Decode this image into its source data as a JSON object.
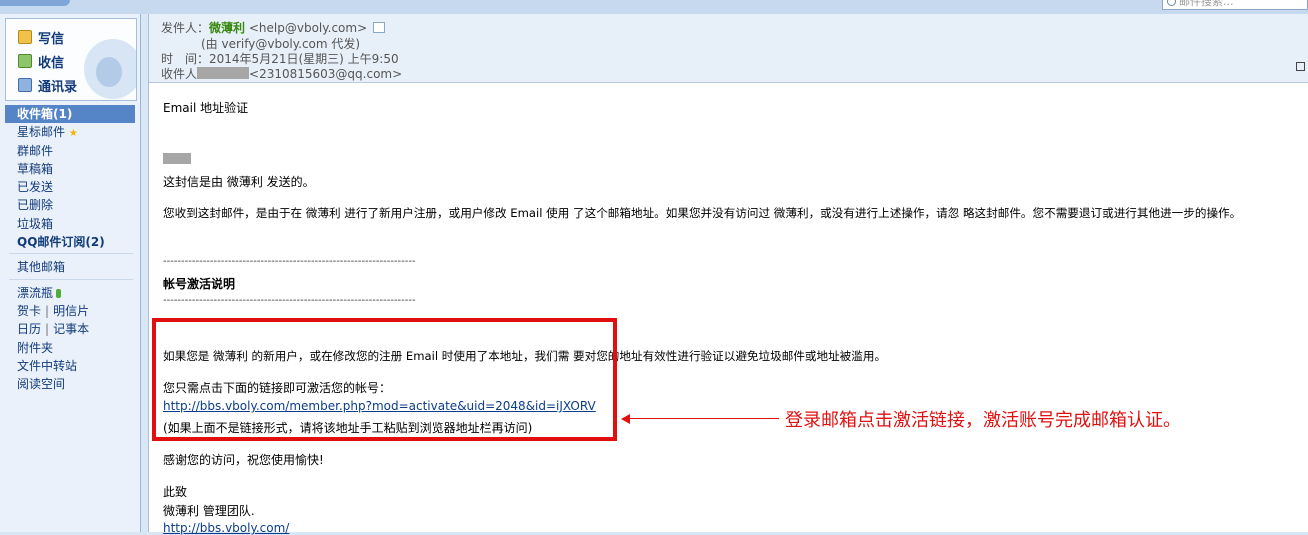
{
  "search": {
    "placeholder": "邮件搜索..."
  },
  "quick_actions": [
    {
      "label": "写信",
      "icon": "compose-icon"
    },
    {
      "label": "收信",
      "icon": "inbox-download-icon"
    },
    {
      "label": "通讯录",
      "icon": "contacts-icon"
    }
  ],
  "folders": {
    "inbox": "收件箱(1)",
    "starred": "星标邮件",
    "group": "群邮件",
    "drafts": "草稿箱",
    "sent": "已发送",
    "deleted": "已删除",
    "spam": "垃圾箱",
    "subscriptions": "QQ邮件订阅(2)",
    "other": "其他邮箱",
    "drift_bottle": "漂流瓶",
    "cards": "贺卡",
    "postcards": "明信片",
    "calendar": "日历",
    "notes": "记事本",
    "attachments": "附件夹",
    "file_transfer": "文件中转站",
    "reading": "阅读空间"
  },
  "header": {
    "from_label": "发件人：",
    "from_name": "微薄利",
    "from_email": "<help@vboly.com>",
    "proxy": "(由 verify@vboly.com 代发)",
    "time_label": "时　间：",
    "time_value": "2014年5月21日(星期三) 上午9:50",
    "to_label": "收件人：",
    "to_email": "<2310815603@qq.com>"
  },
  "body": {
    "subject": "Email 地址验证",
    "line_sent_by": "这封信是由 微薄利 发送的。",
    "line_reason": "您收到这封邮件，是由于在 微薄利 进行了新用户注册，或用户修改 Email 使用 了这个邮箱地址。如果您并没有访问过 微薄利，或没有进行上述操作，请忽 略这封邮件。您不需要退订或进行其他进一步的操作。",
    "divider": "----------------------------------------------------------------------",
    "section_title": "帐号激活说明",
    "line_new_user": "如果您是 微薄利 的新用户，或在修改您的注册 Email 时使用了本地址，我们需 要对您的地址有效性进行验证以避免垃圾邮件或地址被滥用。",
    "line_click": "您只需点击下面的链接即可激活您的帐号：",
    "activation_link": "http://bbs.vboly.com/member.php?mod=activate&uid=2048&id=iJXORV",
    "line_fallback": "(如果上面不是链接形式，请将该地址手工粘贴到浏览器地址栏再访问)",
    "line_thanks": "感谢您的访问，祝您使用愉快!",
    "closing": "此致",
    "signature": "微薄利 管理团队.",
    "site_link": "http://bbs.vboly.com/"
  },
  "annotation": "登录邮箱点击激活链接，激活账号完成邮箱认证。",
  "colors": {
    "annotation_red": "#e01010",
    "selected_folder": "#5585c6",
    "sender_green": "#3a8a12"
  }
}
